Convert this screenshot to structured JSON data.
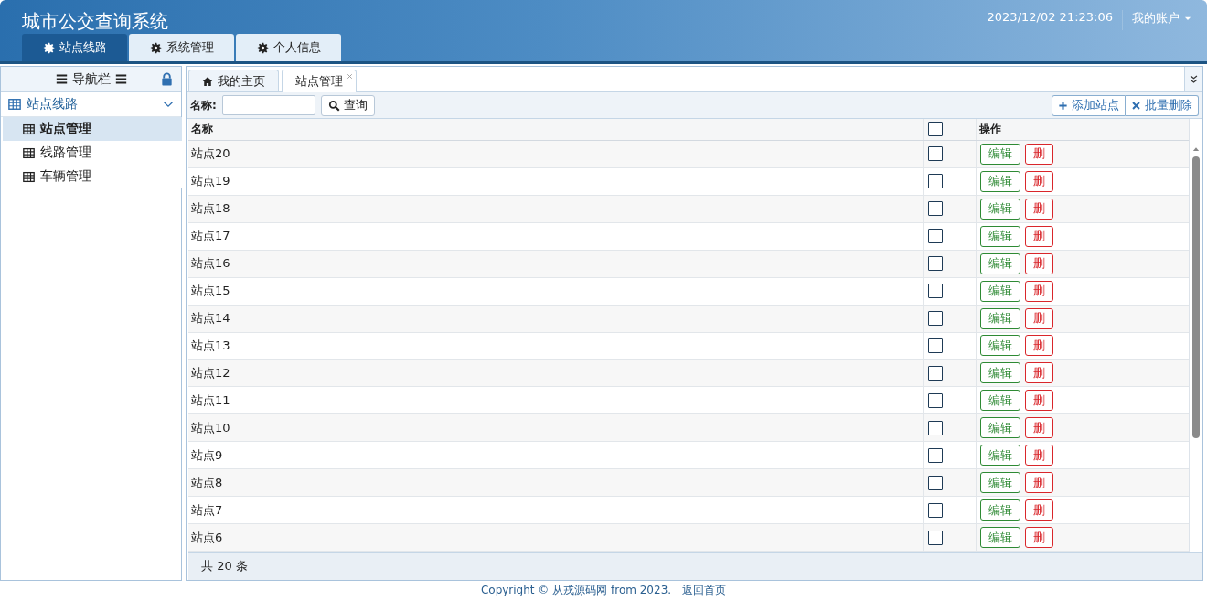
{
  "header": {
    "title": "城市公交查询系统",
    "datetime": "2023/12/02 21:23:06",
    "account": "我的账户",
    "tabs": [
      {
        "label": "站点线路",
        "selected": true
      },
      {
        "label": "系统管理",
        "selected": false
      },
      {
        "label": "个人信息",
        "selected": false
      }
    ]
  },
  "sidebar": {
    "title": "导航栏",
    "group": {
      "label": "站点线路",
      "expanded": true,
      "items": [
        {
          "label": "站点管理",
          "selected": true
        },
        {
          "label": "线路管理",
          "selected": false
        },
        {
          "label": "车辆管理",
          "selected": false
        }
      ]
    }
  },
  "page_tabs": [
    {
      "label": "我的主页",
      "selected": false,
      "closable": false
    },
    {
      "label": "站点管理",
      "selected": true,
      "closable": true
    }
  ],
  "toolbar": {
    "search_label": "名称:",
    "search_button": "查询",
    "actions": [
      {
        "kind": "add",
        "label": "添加站点"
      },
      {
        "kind": "delete",
        "label": "批量删除"
      }
    ]
  },
  "table": {
    "columns": [
      "名称",
      "操作"
    ],
    "header_checked": false,
    "rows": [
      {
        "name": "站点20",
        "checked": false,
        "edit": "编辑",
        "delete": "删"
      },
      {
        "name": "站点19",
        "checked": false,
        "edit": "编辑",
        "delete": "删"
      },
      {
        "name": "站点18",
        "checked": false,
        "edit": "编辑",
        "delete": "删"
      },
      {
        "name": "站点17",
        "checked": false,
        "edit": "编辑",
        "delete": "删"
      },
      {
        "name": "站点16",
        "checked": false,
        "edit": "编辑",
        "delete": "删"
      },
      {
        "name": "站点15",
        "checked": false,
        "edit": "编辑",
        "delete": "删"
      },
      {
        "name": "站点14",
        "checked": false,
        "edit": "编辑",
        "delete": "删"
      },
      {
        "name": "站点13",
        "checked": false,
        "edit": "编辑",
        "delete": "删"
      },
      {
        "name": "站点12",
        "checked": false,
        "edit": "编辑",
        "delete": "删"
      },
      {
        "name": "站点11",
        "checked": false,
        "edit": "编辑",
        "delete": "删"
      },
      {
        "name": "站点10",
        "checked": false,
        "edit": "编辑",
        "delete": "删"
      },
      {
        "name": "站点9",
        "checked": false,
        "edit": "编辑",
        "delete": "删"
      },
      {
        "name": "站点8",
        "checked": false,
        "edit": "编辑",
        "delete": "删"
      },
      {
        "name": "站点7",
        "checked": false,
        "edit": "编辑",
        "delete": "删"
      },
      {
        "name": "站点6",
        "checked": false,
        "edit": "编辑",
        "delete": "删"
      }
    ]
  },
  "pager": {
    "total": "共 20 条"
  },
  "footer": {
    "copyright": "Copyright © 从戎源码网 from 2023.",
    "link": "返回首页"
  }
}
